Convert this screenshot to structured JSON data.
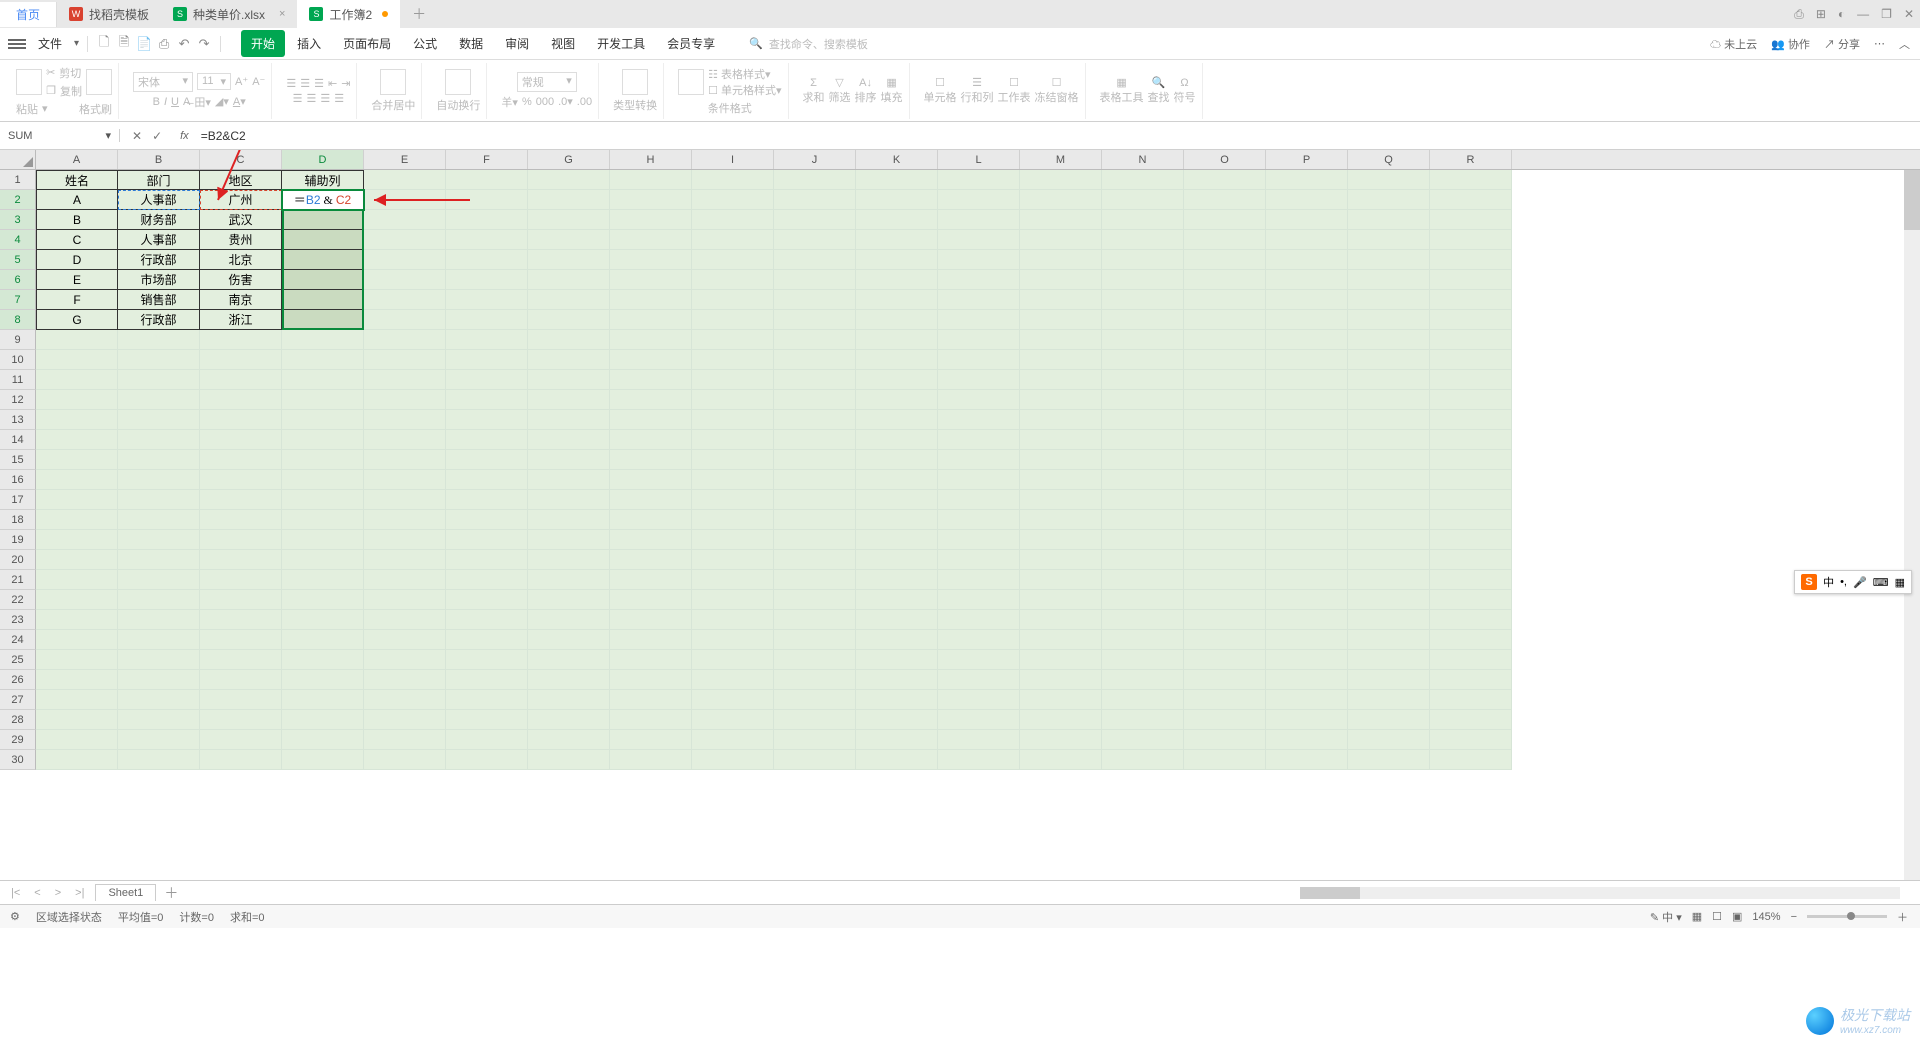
{
  "title_tabs": {
    "home": "首页",
    "files": [
      {
        "icon": "red",
        "iconText": "W",
        "name": "找稻壳模板"
      },
      {
        "icon": "green",
        "iconText": "S",
        "name": "种类单价.xlsx"
      },
      {
        "icon": "green",
        "iconText": "S",
        "name": "工作簿2",
        "modified": true,
        "active": true
      }
    ],
    "win_icons": [
      "⎙",
      "⊞",
      "◐",
      "—",
      "❐",
      "✕"
    ]
  },
  "menu": {
    "file": "文件",
    "quick_icons": [
      "🗋",
      "🗎",
      "📄",
      "⎙",
      "↶",
      "↷"
    ],
    "tabs": [
      "开始",
      "插入",
      "页面布局",
      "公式",
      "数据",
      "审阅",
      "视图",
      "开发工具",
      "会员专享"
    ],
    "active_tab": "开始",
    "search_placeholder": "查找命令、搜索模板",
    "right": {
      "cloud": "未上云",
      "collab": "协作",
      "share": "分享"
    }
  },
  "ribbon": {
    "paste": "粘贴",
    "cut": "剪切",
    "copy": "复制",
    "format_painter": "格式刷",
    "font_name": "宋体",
    "font_size": "11",
    "merge": "合并居中",
    "wrap": "自动换行",
    "number_format": "常规",
    "type_convert": "类型转换",
    "cond_fmt": "条件格式",
    "table_style": "表格样式",
    "cell_style": "单元格样式",
    "sum": "求和",
    "filter": "筛选",
    "sort": "排序",
    "fill": "填充",
    "cell": "单元格",
    "rowcol": "行和列",
    "worksheet": "工作表",
    "freeze": "冻结窗格",
    "table_tool": "表格工具",
    "find": "查找",
    "symbol": "符号"
  },
  "formula_bar": {
    "name_box": "SUM",
    "formula": "=B2&C2"
  },
  "columns": [
    "A",
    "B",
    "C",
    "D",
    "E",
    "F",
    "G",
    "H",
    "I",
    "J",
    "K",
    "L",
    "M",
    "N",
    "O",
    "P",
    "Q",
    "R"
  ],
  "row_numbers": [
    1,
    2,
    3,
    4,
    5,
    6,
    7,
    8,
    9,
    10,
    11,
    12,
    13,
    14,
    15,
    16,
    17,
    18,
    19,
    20,
    21,
    22,
    23,
    24,
    25,
    26,
    27,
    28,
    29,
    30
  ],
  "table": {
    "headers": [
      "姓名",
      "部门",
      "地区",
      "辅助列"
    ],
    "rows": [
      [
        "A",
        "人事部",
        "广州"
      ],
      [
        "B",
        "财务部",
        "武汉"
      ],
      [
        "C",
        "人事部",
        "贵州"
      ],
      [
        "D",
        "行政部",
        "北京"
      ],
      [
        "E",
        "市场部",
        "伤害"
      ],
      [
        "F",
        "销售部",
        "南京"
      ],
      [
        "G",
        "行政部",
        "浙江"
      ]
    ],
    "active_formula_parts": {
      "prefix": "＝",
      "b": "B2",
      "amp": " & ",
      "c": "C2"
    }
  },
  "ime": {
    "logo": "S",
    "lang": "中",
    "punct": "•,",
    "mic": "🎤",
    "kbd": "⌨",
    "menu": "▦"
  },
  "sheet_tabs": {
    "name": "Sheet1"
  },
  "status": {
    "mode": "区域选择状态",
    "avg": "平均值=0",
    "count": "计数=0",
    "sum": "求和=0",
    "ime2": "中",
    "zoom": "145%"
  },
  "watermark": {
    "text": "极光下载站",
    "url": "www.xz7.com"
  }
}
